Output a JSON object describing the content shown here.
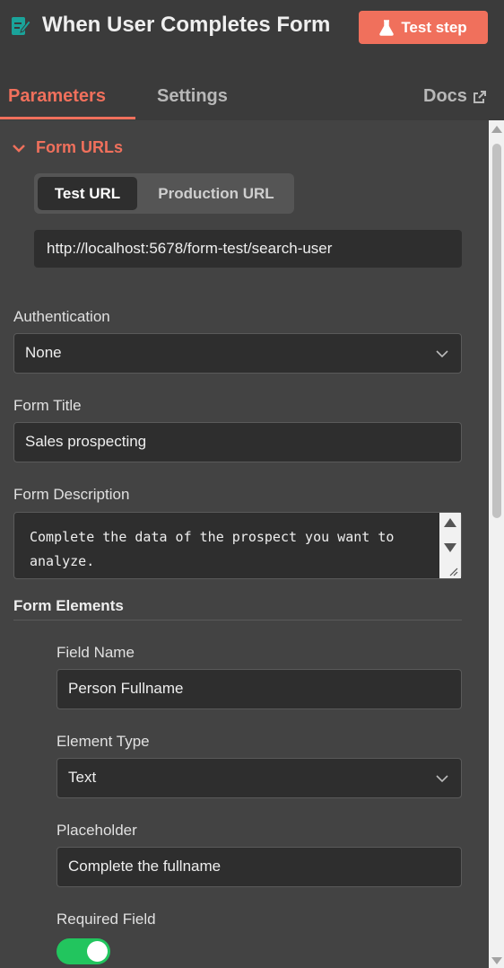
{
  "header": {
    "title": "When User Completes Form",
    "test_step_label": "Test step",
    "tabs": [
      {
        "label": "Parameters",
        "active": true
      },
      {
        "label": "Settings",
        "active": false
      }
    ],
    "docs_label": "Docs"
  },
  "form_urls": {
    "heading": "Form URLs",
    "segments": [
      "Test URL",
      "Production URL"
    ],
    "selected": "Test URL",
    "url": "http://localhost:5678/form-test/search-user"
  },
  "authentication": {
    "label": "Authentication",
    "value": "None"
  },
  "form_title": {
    "label": "Form Title",
    "value": "Sales prospecting"
  },
  "form_description": {
    "label": "Form Description",
    "value": "Complete the data of the prospect you want to analyze."
  },
  "form_elements": {
    "heading": "Form Elements",
    "field_name": {
      "label": "Field Name",
      "value": "Person Fullname"
    },
    "element_type": {
      "label": "Element Type",
      "value": "Text"
    },
    "placeholder": {
      "label": "Placeholder",
      "value": "Complete the fullname"
    },
    "required": {
      "label": "Required Field",
      "value": true
    }
  },
  "colors": {
    "accent": "#f0705c",
    "toggle_on": "#22c55e",
    "panel_bg": "#434343"
  }
}
